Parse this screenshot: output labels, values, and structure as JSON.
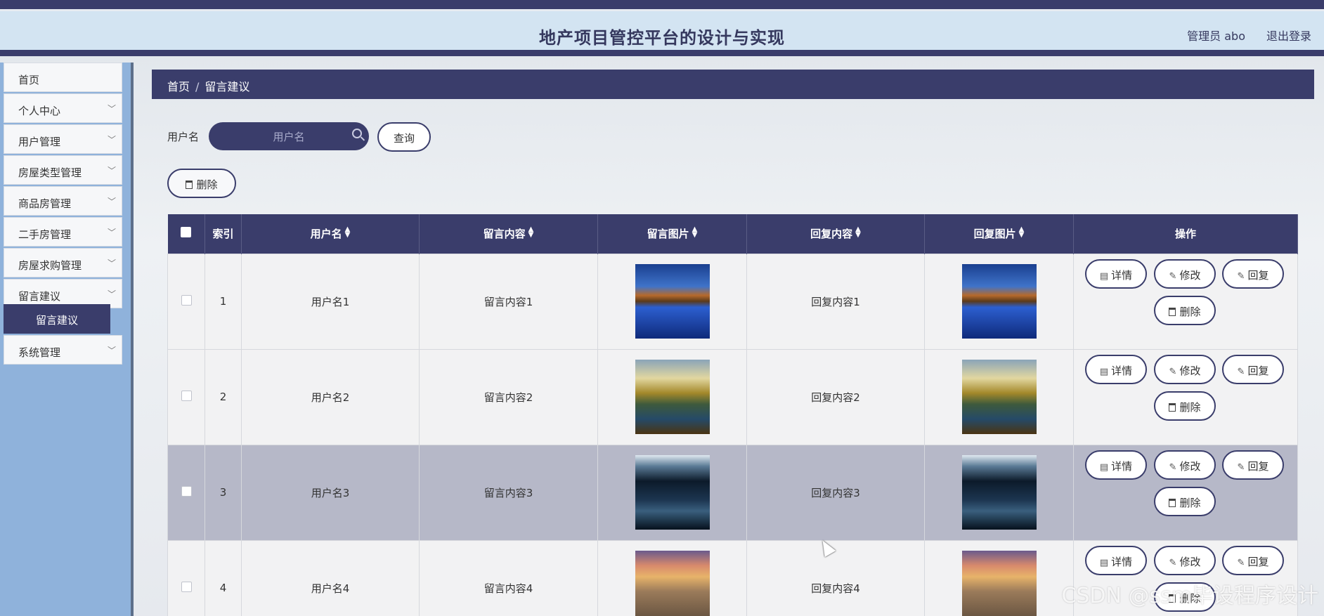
{
  "header": {
    "title": "地产项目管控平台的设计与实现",
    "user": "管理员 abo",
    "logout": "退出登录"
  },
  "sidebar": {
    "items": [
      {
        "label": "首页",
        "has_children": false
      },
      {
        "label": "个人中心",
        "has_children": true
      },
      {
        "label": "用户管理",
        "has_children": true
      },
      {
        "label": "房屋类型管理",
        "has_children": true
      },
      {
        "label": "商品房管理",
        "has_children": true
      },
      {
        "label": "二手房管理",
        "has_children": true
      },
      {
        "label": "房屋求购管理",
        "has_children": true
      },
      {
        "label": "留言建议",
        "has_children": true
      },
      {
        "label": "系统管理",
        "has_children": true
      }
    ],
    "active_sub": "留言建议"
  },
  "breadcrumb": {
    "home": "首页",
    "separator": "/",
    "current": "留言建议"
  },
  "search": {
    "label": "用户名",
    "placeholder": "用户名",
    "query_button": "查询"
  },
  "toolbar": {
    "delete_button": "删除"
  },
  "table": {
    "columns": [
      "索引",
      "用户名",
      "留言内容",
      "留言图片",
      "回复内容",
      "回复图片",
      "操作"
    ],
    "rows": [
      {
        "index": "1",
        "username": "用户名1",
        "content": "留言内容1",
        "reply": "回复内容1",
        "image": "img-lake",
        "highlighted": false
      },
      {
        "index": "2",
        "username": "用户名2",
        "content": "留言内容2",
        "reply": "回复内容2",
        "image": "img-tree",
        "highlighted": false
      },
      {
        "index": "3",
        "username": "用户名3",
        "content": "留言内容3",
        "reply": "回复内容3",
        "image": "img-river",
        "highlighted": true
      },
      {
        "index": "4",
        "username": "用户名4",
        "content": "留言内容4",
        "reply": "回复内容4",
        "image": "img-rainbow",
        "highlighted": false
      }
    ],
    "actions": {
      "detail": "详情",
      "edit": "修改",
      "reply": "回复",
      "delete": "删除"
    }
  },
  "watermark": "CSDN @ssm毕设程序设计",
  "colors": {
    "primary": "#3a3d6b",
    "sidebar": "#8fb2db",
    "header_bg": "#d3e4f2"
  }
}
